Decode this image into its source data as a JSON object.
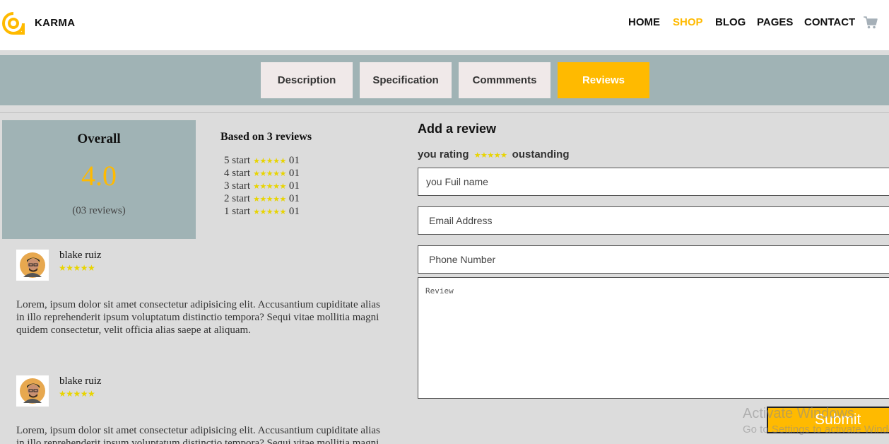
{
  "brand": {
    "name": "KARMA",
    "accent": "#ffba00"
  },
  "nav": {
    "items": [
      "HOME",
      "SHOP",
      "BLOG",
      "PAGES",
      "CONTACT"
    ],
    "active": "SHOP",
    "cart_icon": "cart-icon"
  },
  "tabs": {
    "items": [
      "Description",
      "Specification",
      "Commments",
      "Reviews"
    ],
    "active": "Reviews"
  },
  "overall": {
    "title": "Overall",
    "score": "4.0",
    "count": "(03 reviews)"
  },
  "breakdown": {
    "title": "Based on 3 reviews",
    "rows": [
      {
        "label": "5 start",
        "stars": "★★★★★",
        "count": "01"
      },
      {
        "label": "4 start",
        "stars": "★★★★★",
        "count": "01"
      },
      {
        "label": "3 start",
        "stars": "★★★★★",
        "count": "01"
      },
      {
        "label": "2 start",
        "stars": "★★★★★",
        "count": "01"
      },
      {
        "label": "1 start",
        "stars": "★★★★★",
        "count": "01"
      }
    ]
  },
  "reviews": [
    {
      "name": "blake ruiz",
      "stars": "★★★★★",
      "text": "Lorem, ipsum dolor sit amet consectetur adipisicing elit. Accusantium cupiditate alias in illo reprehenderit ipsum voluptatum distinctio tempora? Sequi vitae mollitia magni quidem consectetur, velit officia alias saepe at aliquam."
    },
    {
      "name": "blake ruiz",
      "stars": "★★★★★",
      "text": "Lorem, ipsum dolor sit amet consectetur adipisicing elit. Accusantium cupiditate alias in illo reprehenderit ipsum voluptatum distinctio tempora? Sequi vitae mollitia magni quidem consectetur, velit officia alias saepe at aliquam."
    }
  ],
  "form": {
    "title": "Add a review",
    "rating_label": "you rating",
    "rating_stars": "★★★★★",
    "rating_word": "oustanding",
    "name_placeholder": "you Fuil name",
    "email_placeholder": "Email Address",
    "phone_placeholder": "Phone Number",
    "review_placeholder": "Review",
    "submit_label": "Submit"
  },
  "watermark": {
    "line1": "Activate Windows",
    "line2": "Go to Settings to activate Windows."
  }
}
